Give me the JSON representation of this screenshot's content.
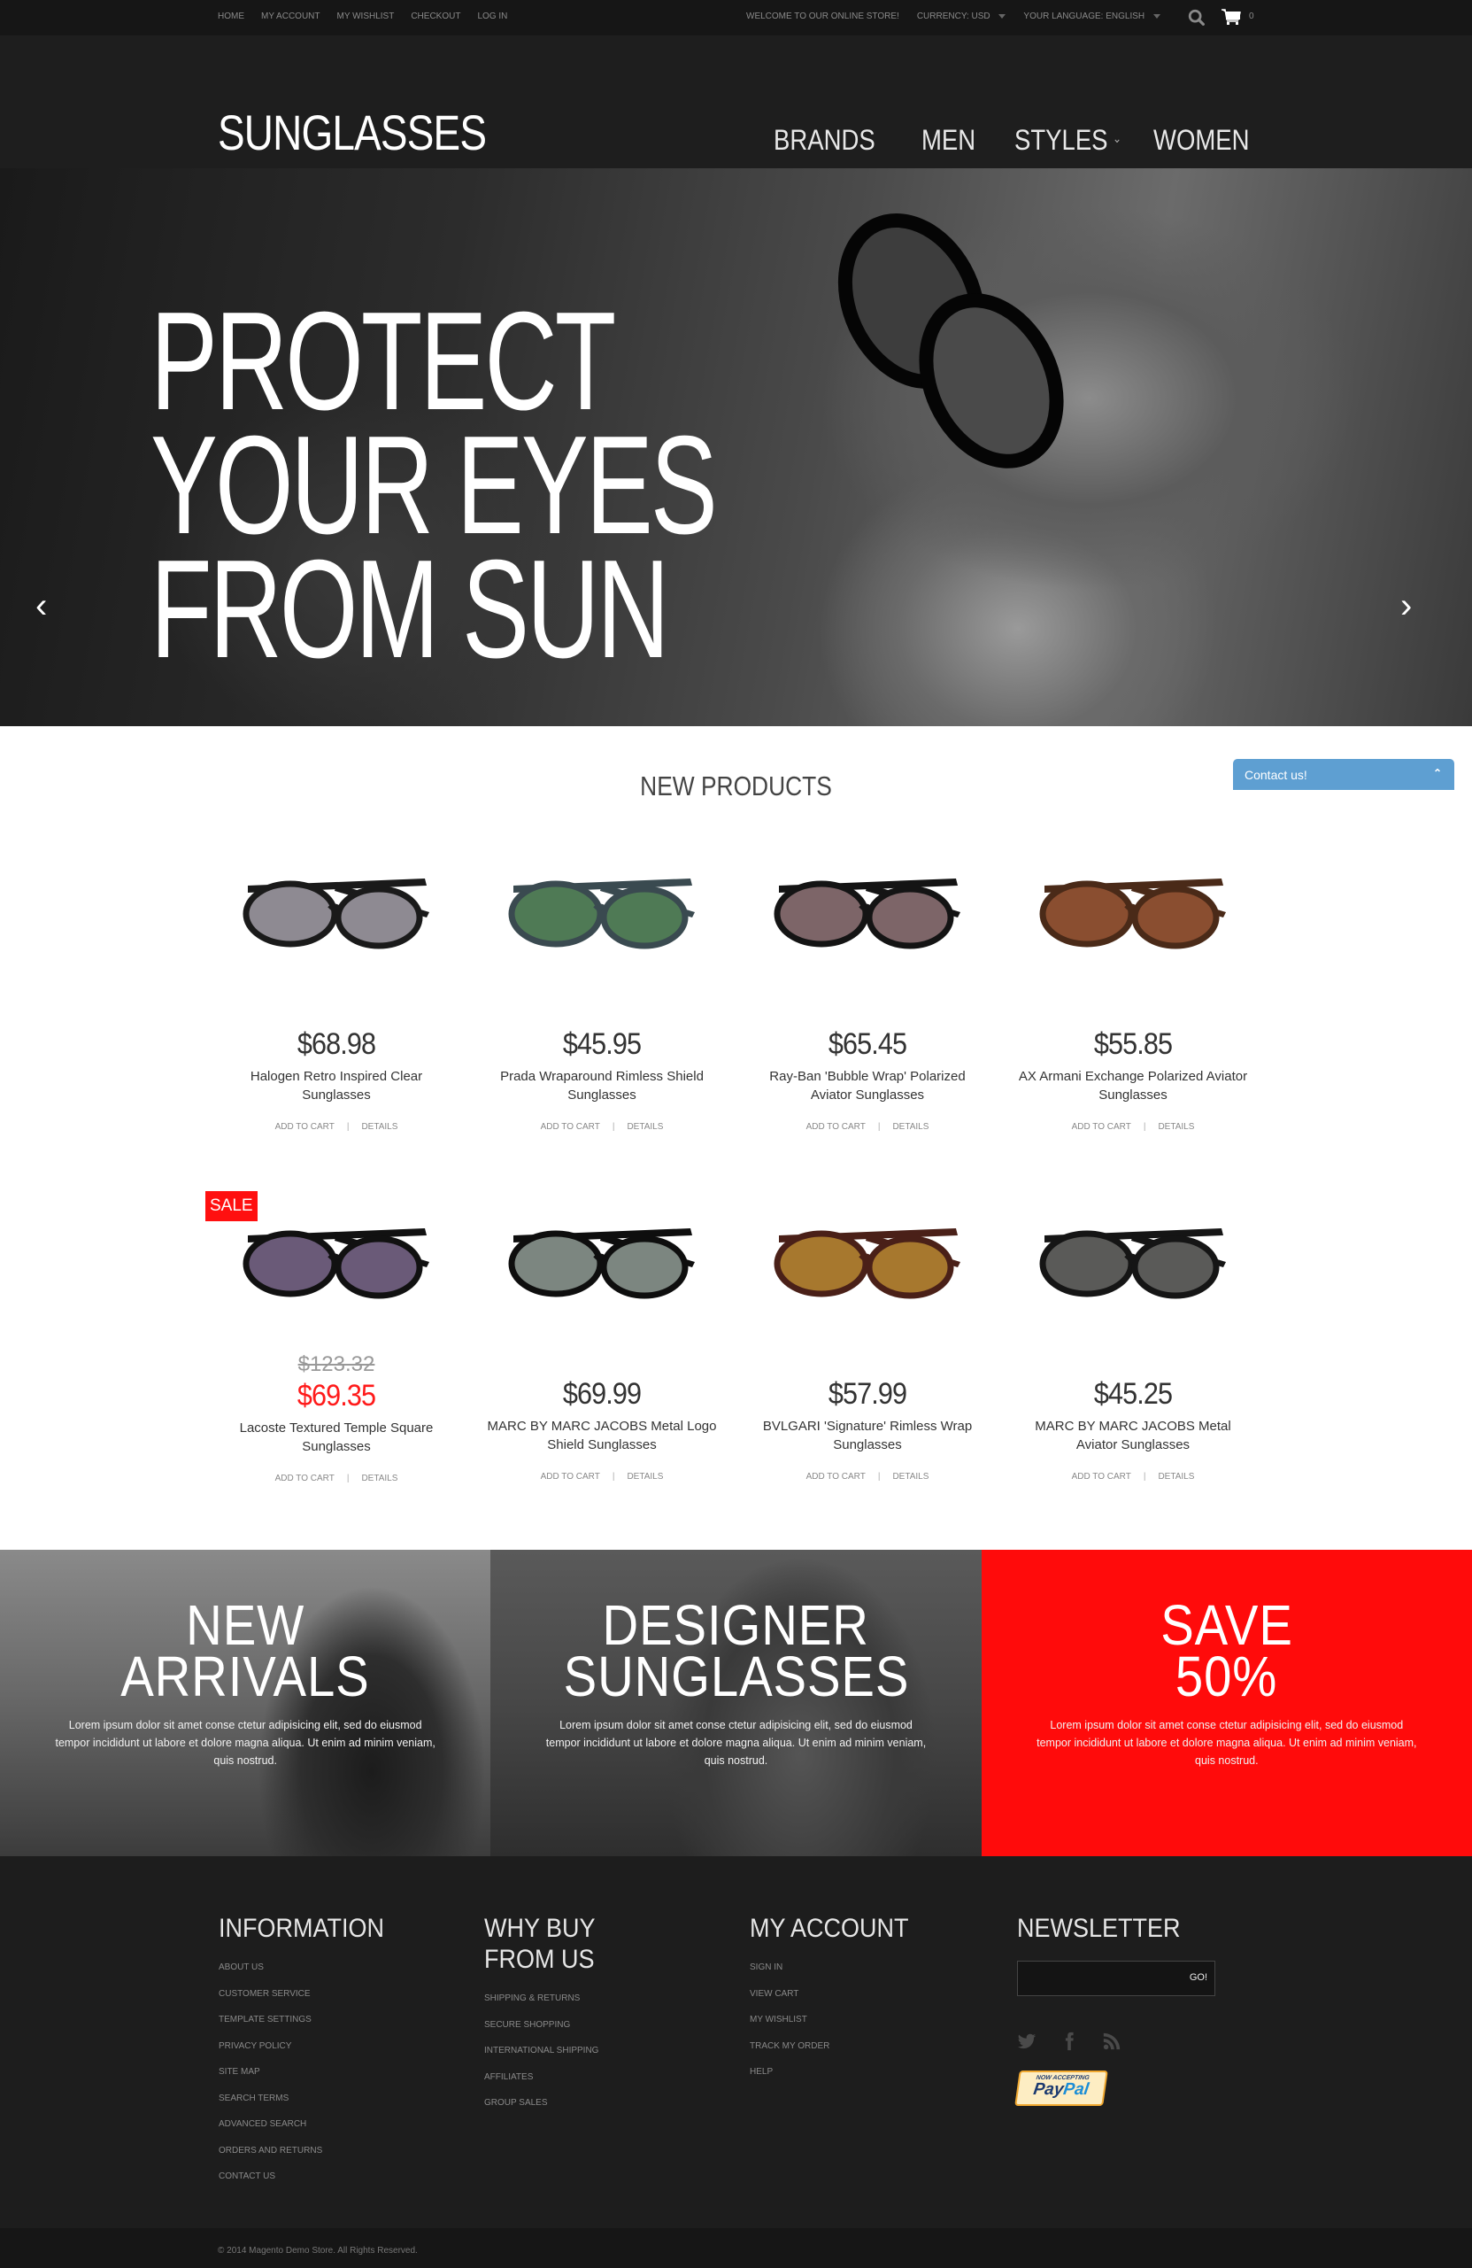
{
  "topbar": {
    "links": [
      "HOME",
      "MY ACCOUNT",
      "MY WISHLIST",
      "CHECKOUT",
      "LOG IN"
    ],
    "welcome": "WELCOME TO OUR ONLINE STORE!",
    "currency_label": "CURRENCY:",
    "currency_value": "USD",
    "language_label": "YOUR LANGUAGE:",
    "language_value": "ENGLISH",
    "search_icon": "search-icon",
    "cart_icon": "cart-icon",
    "cart_count": "0"
  },
  "header": {
    "logo": "SUNGLASSES",
    "nav": [
      "BRANDS",
      "MEN",
      "STYLES",
      "WOMEN"
    ],
    "styles_has_dropdown": true
  },
  "hero": {
    "lines": [
      "PROTECT",
      "YOUR EYES",
      "FROM SUN"
    ],
    "prev_icon": "chevron-left-icon",
    "next_icon": "chevron-right-icon"
  },
  "contact_tab": {
    "label": "Contact us!",
    "icon": "chevron-up-icon",
    "color": "#5e9fd2"
  },
  "products": {
    "title": "NEW PRODUCTS",
    "add_to_cart_label": "ADD TO CART",
    "details_label": "DETAILS",
    "sale_badge": "SALE",
    "sale_color": "#ff1010",
    "items": [
      {
        "name": "Halogen Retro Inspired Clear Sunglasses",
        "price": "$68.98",
        "old_price": null,
        "sale": false,
        "frame": "#1a1a1a",
        "lens": "#8e8a92"
      },
      {
        "name": "Prada Wraparound Rimless Shield Sunglasses",
        "price": "$45.95",
        "old_price": null,
        "sale": false,
        "frame": "#3a4a50",
        "lens": "#4f7a55"
      },
      {
        "name": "Ray-Ban 'Bubble Wrap' Polarized Aviator Sunglasses",
        "price": "$65.45",
        "old_price": null,
        "sale": false,
        "frame": "#141414",
        "lens": "#7d6568"
      },
      {
        "name": "AX Armani Exchange Polarized Aviator Sunglasses",
        "price": "$55.85",
        "old_price": null,
        "sale": false,
        "frame": "#4a2a18",
        "lens": "#8a4e30"
      },
      {
        "name": "Lacoste Textured Temple Square Sunglasses",
        "price": "$69.35",
        "old_price": "$123.32",
        "sale": true,
        "frame": "#111111",
        "lens": "#6a5a78"
      },
      {
        "name": "MARC BY MARC JACOBS Metal Logo Shield Sunglasses",
        "price": "$69.99",
        "old_price": null,
        "sale": false,
        "frame": "#0e0e0e",
        "lens": "#7c8680"
      },
      {
        "name": "BVLGARI 'Signature' Rimless Wrap Sunglasses",
        "price": "$57.99",
        "old_price": null,
        "sale": false,
        "frame": "#4a2018",
        "lens": "#a7782e"
      },
      {
        "name": "MARC BY MARC JACOBS Metal Aviator Sunglasses",
        "price": "$45.25",
        "old_price": null,
        "sale": false,
        "frame": "#151515",
        "lens": "#5a5a58"
      }
    ]
  },
  "banners": [
    {
      "title_lines": [
        "NEW",
        "ARRIVALS"
      ],
      "text": "Lorem ipsum dolor sit amet conse ctetur adipisicing elit, sed do eiusmod tempor incididunt ut labore et dolore magna aliqua. Ut enim ad minim veniam, quis nostrud."
    },
    {
      "title_lines": [
        "DESIGNER",
        "SUNGLASSES"
      ],
      "text": "Lorem ipsum dolor sit amet conse ctetur adipisicing elit, sed do eiusmod tempor incididunt ut labore et dolore magna aliqua. Ut enim ad minim veniam, quis nostrud."
    },
    {
      "title_lines": [
        "SAVE",
        "50%"
      ],
      "text": "Lorem ipsum dolor sit amet conse ctetur adipisicing elit, sed do eiusmod tempor incididunt ut labore et dolore magna aliqua. Ut enim ad minim veniam, quis nostrud.",
      "color": "#ff0b0b"
    }
  ],
  "footer": {
    "information": {
      "title": "INFORMATION",
      "links": [
        "ABOUT US",
        "CUSTOMER SERVICE",
        "TEMPLATE SETTINGS",
        "PRIVACY POLICY",
        "SITE MAP",
        "SEARCH TERMS",
        "ADVANCED SEARCH",
        "ORDERS AND RETURNS",
        "CONTACT US"
      ]
    },
    "why_buy": {
      "title_lines": [
        "WHY BUY",
        "FROM US"
      ],
      "links": [
        "SHIPPING & RETURNS",
        "SECURE SHOPPING",
        "INTERNATIONAL SHIPPING",
        "AFFILIATES",
        "GROUP SALES"
      ]
    },
    "my_account": {
      "title": "MY ACCOUNT",
      "links": [
        "SIGN IN",
        "VIEW CART",
        "MY WISHLIST",
        "TRACK MY ORDER",
        "HELP"
      ]
    },
    "newsletter": {
      "title": "NEWSLETTER",
      "input_value": "",
      "input_placeholder": "",
      "button": "GO!",
      "social": [
        "twitter-icon",
        "facebook-icon",
        "rss-icon"
      ],
      "paypal_top": "NOW ACCEPTING",
      "paypal_pay": "Pay",
      "paypal_pal": "Pal"
    },
    "copyright": "© 2014 Magento Demo Store. All Rights Reserved."
  }
}
